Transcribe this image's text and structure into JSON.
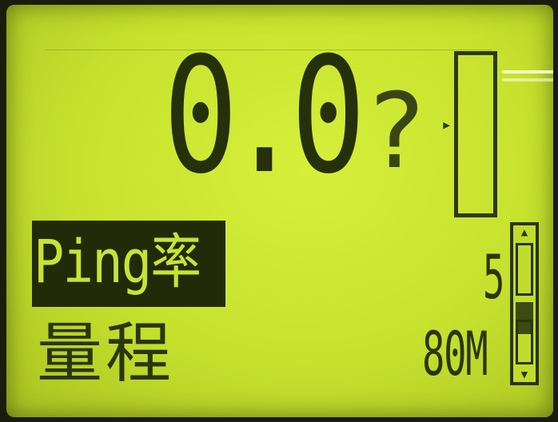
{
  "display": {
    "reading": "0.0",
    "unknown_symbol": "?",
    "pointer_glyph": "▸"
  },
  "menu": {
    "selected_tab": "Ping率",
    "range_label": "量程"
  },
  "values": {
    "rate": "5",
    "range": "80M"
  },
  "scrollbar": {
    "up_glyph": "▲",
    "down_glyph": "▼"
  },
  "colors": {
    "lcd_background": "#c6e22e",
    "lcd_ink": "#26300a",
    "highlight": "#222a08"
  }
}
